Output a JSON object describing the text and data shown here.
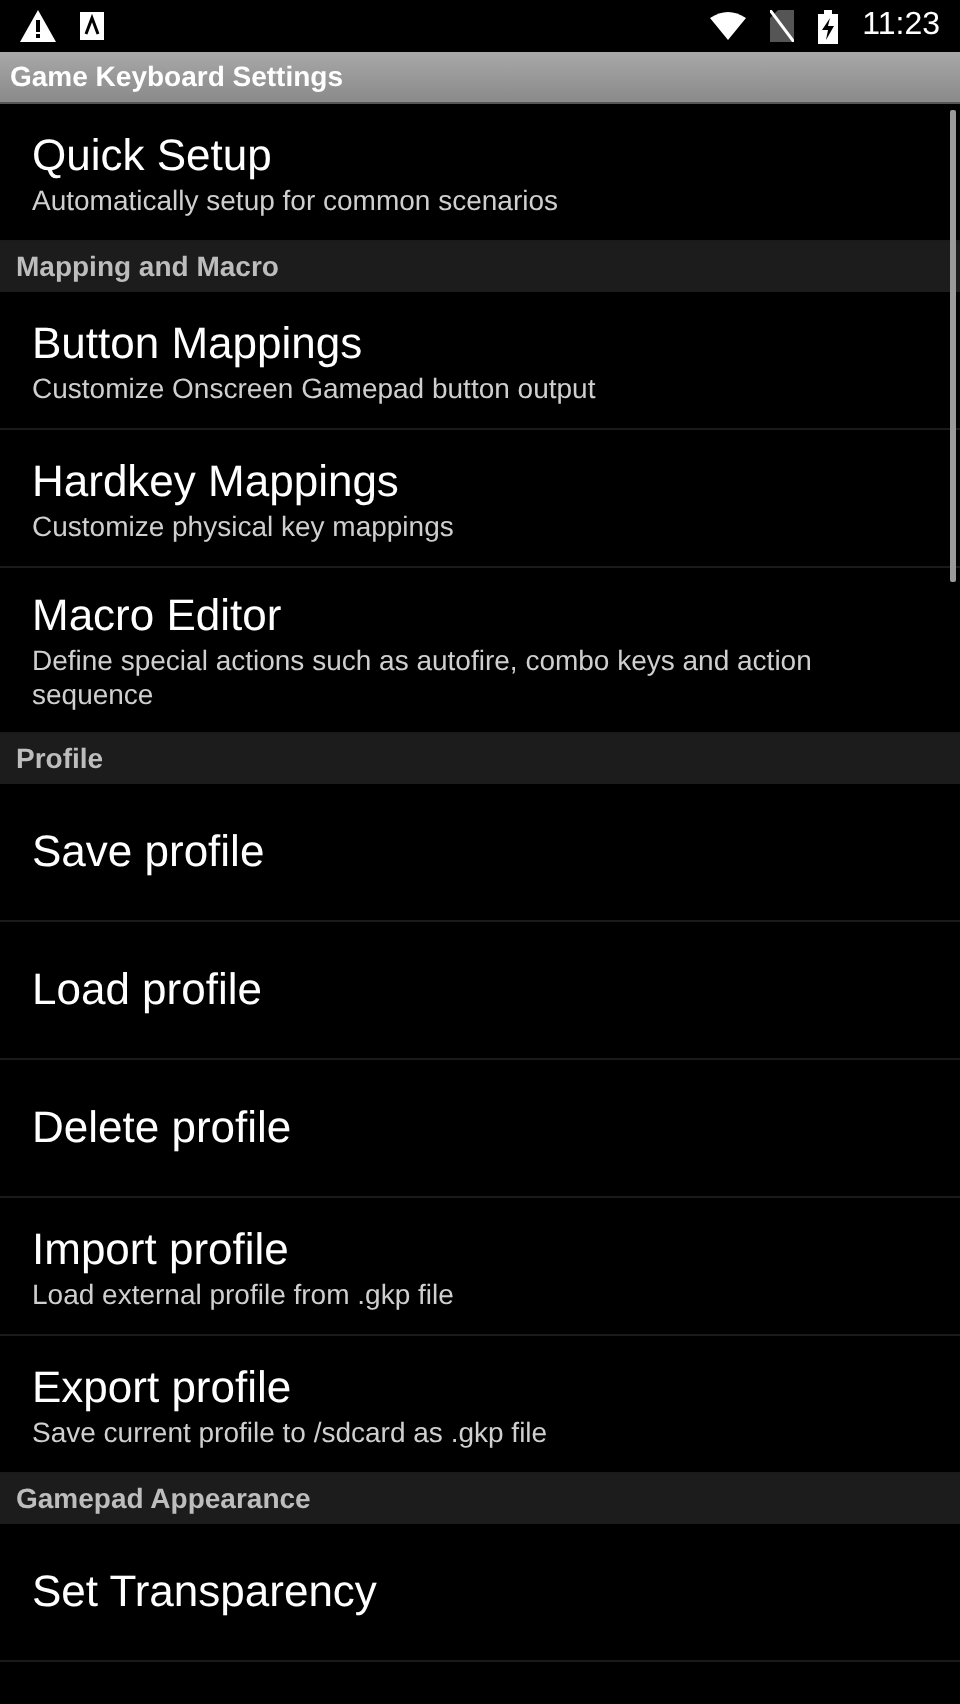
{
  "status_bar": {
    "time": "11:23"
  },
  "title_bar": {
    "title": "Game Keyboard Settings"
  },
  "list": [
    {
      "kind": "item",
      "title": "Quick Setup",
      "summary": "Automatically setup for common scenarios"
    },
    {
      "kind": "header",
      "title": "Mapping and Macro"
    },
    {
      "kind": "item",
      "title": "Button Mappings",
      "summary": "Customize Onscreen Gamepad button output"
    },
    {
      "kind": "item",
      "title": "Hardkey Mappings",
      "summary": "Customize physical key mappings"
    },
    {
      "kind": "item",
      "title": "Macro Editor",
      "summary": "Define special actions such as autofire, combo keys and action sequence"
    },
    {
      "kind": "header",
      "title": "Profile"
    },
    {
      "kind": "item",
      "title": "Save profile"
    },
    {
      "kind": "item",
      "title": "Load profile"
    },
    {
      "kind": "item",
      "title": "Delete profile"
    },
    {
      "kind": "item",
      "title": "Import profile",
      "summary": "Load external profile from .gkp file"
    },
    {
      "kind": "item",
      "title": "Export profile",
      "summary": "Save current profile to /sdcard as .gkp file"
    },
    {
      "kind": "header",
      "title": "Gamepad Appearance"
    },
    {
      "kind": "item",
      "title": "Set Transparency"
    }
  ]
}
